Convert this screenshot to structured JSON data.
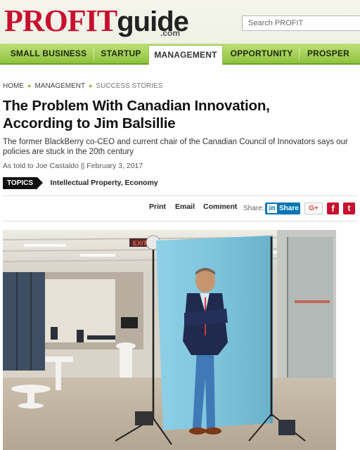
{
  "header": {
    "logo": {
      "profit": "PROFIT",
      "guide": "guide",
      "dotcom": ".com"
    },
    "search": {
      "placeholder": "Search PROFIT"
    }
  },
  "nav": {
    "items": [
      {
        "label": "SMALL BUSINESS"
      },
      {
        "label": "STARTUP"
      },
      {
        "label": "MANAGEMENT",
        "active": true
      },
      {
        "label": "OPPORTUNITY"
      },
      {
        "label": "PROSPER"
      }
    ]
  },
  "breadcrumb": {
    "home": "HOME",
    "section": "MANAGEMENT",
    "current": "SUCCESS STORIES"
  },
  "article": {
    "title_line1": "The Problem With Canadian Innovation,",
    "title_line2": "According to Jim Balsillie",
    "dek": "The former BlackBerry co-CEO and current chair of the Canadian Council of Innovators says our policies are stuck in the 20th century",
    "byline": "As told to Joe Castaldo || February 3, 2017",
    "topics_label": "TOPICS",
    "topics": "Intellectual Property, Economy"
  },
  "actions": {
    "print": "Print",
    "email": "Email",
    "comment": "Comment",
    "share_label": "Share:",
    "linkedin_share": "Share",
    "linkedin_in": "in",
    "gplus": "G+",
    "facebook": "f",
    "twitter": "t"
  },
  "photo": {
    "sign_text": "EXIT"
  },
  "colors": {
    "brand_red": "#c8102e",
    "nav_green": "#8ec23c",
    "linkedin_blue": "#0077b5",
    "backdrop_blue": "#7ec5dc"
  }
}
